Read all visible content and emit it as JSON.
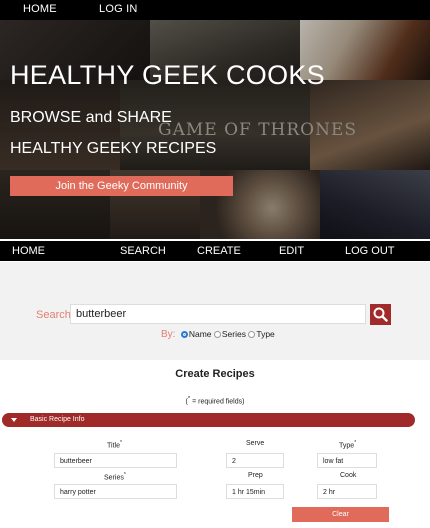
{
  "top_nav": {
    "home": "HOME",
    "login": "LOG IN"
  },
  "hero": {
    "title": "HEALTHY GEEK COOKS",
    "subtitle_1": "BROWSE and SHARE",
    "subtitle_2": "HEALTHY GEEKY RECIPES",
    "join_button": "Join the Geeky Community",
    "image_text": "GAME OF THRONES"
  },
  "main_nav": {
    "home": "HOME",
    "search": "SEARCH",
    "create": "CREATE",
    "edit": "EDIT",
    "logout": "LOG OUT"
  },
  "search": {
    "label": "Search:",
    "value": "butterbeer",
    "by_label": "By:",
    "options": [
      "Name",
      "Series",
      "Type"
    ],
    "selected": "Name"
  },
  "create": {
    "title": "Create Recipes",
    "required_note_prefix": "(",
    "required_note_star": "*",
    "required_note_suffix": " = required fields)",
    "section_label": "Basic Recipe Info",
    "fields": {
      "title": {
        "label": "Title",
        "value": "butterbeer"
      },
      "serve": {
        "label": "Serve",
        "value": "2"
      },
      "type": {
        "label": "Type",
        "value": "low fat"
      },
      "series": {
        "label": "Series",
        "value": "harry potter"
      },
      "prep": {
        "label": "Prep",
        "value": "1 hr 15min"
      },
      "cook": {
        "label": "Cook",
        "value": "2 hr"
      }
    },
    "required_star": "*",
    "clear_button": "Clear"
  },
  "colors": {
    "accent": "#e06b5b",
    "dark_red": "#a12b2b",
    "nav_bg": "#000000",
    "search_bg": "#f2f2f2"
  },
  "icons": {
    "search_button": "search-icon",
    "section_toggle": "chevron-down-icon"
  }
}
